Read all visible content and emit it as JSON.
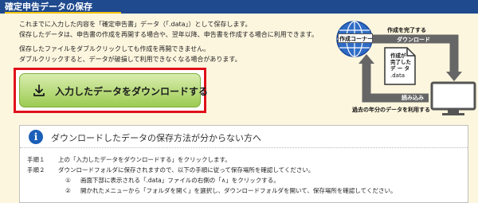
{
  "header": {
    "title": "確定申告データの保存"
  },
  "description": [
    "これまでに入力した内容を「確定申告書」データ（「.data」）として保存します。",
    "保存したデータは、申告書の作成を再開する場合や、翌年以降、申告書を作成する場合に利用できます。",
    "保存したファイルをダブルクリックしても作成を再開できません。",
    "ダブルクリックすると、データが破損して利用できなくなる場合があります。"
  ],
  "download_button": {
    "label": "入力したデータをダウンロードする",
    "icon": "download-icon"
  },
  "diagram": {
    "center_label": "作成コーナー",
    "finish_label": "作成を完了する",
    "download_label": "ダウンロード",
    "file_label": [
      "作成が",
      "完了した",
      "デ ー タ",
      ".data"
    ],
    "load_label": "読み込み",
    "reuse_label": "過去の年分のデータを利用する"
  },
  "help_box": {
    "icon": "info-icon",
    "title": "ダウンロードしたデータの保存方法が分からない方へ",
    "steps": [
      {
        "label": "手順１",
        "text": "上の「入力したデータをダウンロードする」をクリックします。"
      },
      {
        "label": "手順２",
        "text": "ダウンロードフォルダに保存されますので、以下の手順に従って保存場所を確認してください。"
      }
    ],
    "substeps": [
      {
        "num": "①",
        "text": "画面下部に表示される「.data」ファイルの右側の「∧」をクリックする。"
      },
      {
        "num": "②",
        "text": "開かれたメニューから「フォルダを開く」を選択し、ダウンロードフォルダを開いて、保存場所を確認してください。"
      }
    ]
  },
  "colors": {
    "header_bg": "#1f4a8e",
    "page_bg": "#fdf6df",
    "button_highlight": "#e0101a",
    "button_green": "#9ccb52"
  }
}
